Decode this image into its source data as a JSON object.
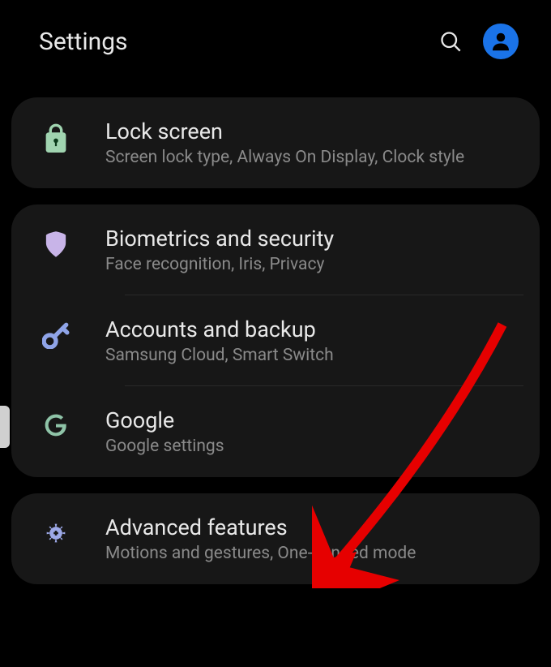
{
  "header": {
    "title": "Settings"
  },
  "groups": [
    {
      "items": [
        {
          "id": "lock-screen",
          "title": "Lock screen",
          "subtitle": "Screen lock type, Always On Display, Clock style",
          "icon": "lock-icon",
          "divider": false
        }
      ]
    },
    {
      "items": [
        {
          "id": "biometrics",
          "title": "Biometrics and security",
          "subtitle": "Face recognition, Iris, Privacy",
          "icon": "shield-icon",
          "divider": true
        },
        {
          "id": "accounts",
          "title": "Accounts and backup",
          "subtitle": "Samsung Cloud, Smart Switch",
          "icon": "key-icon",
          "divider": true
        },
        {
          "id": "google",
          "title": "Google",
          "subtitle": "Google settings",
          "icon": "google-icon",
          "divider": false
        }
      ]
    },
    {
      "items": [
        {
          "id": "advanced",
          "title": "Advanced features",
          "subtitle": "Motions and gestures, One-handed mode",
          "icon": "gear-icon",
          "divider": false
        }
      ]
    }
  ],
  "colors": {
    "lock": "#a0d4b0",
    "shield": "#c8b4e8",
    "key": "#8fa4e8",
    "google": "#8fc4a8",
    "gear": "#9da9e8",
    "profile": "#1a73e8"
  }
}
